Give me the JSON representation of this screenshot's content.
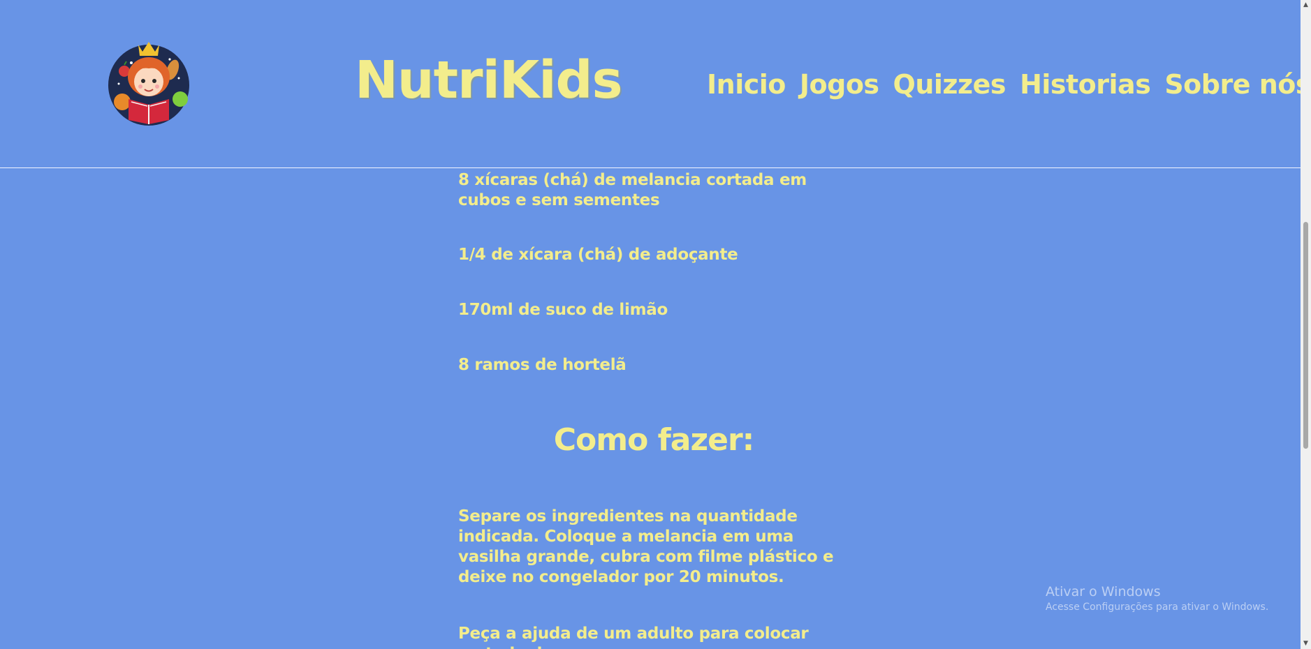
{
  "header": {
    "brand": "NutriKids",
    "nav": [
      {
        "label": "Inicio"
      },
      {
        "label": "Jogos"
      },
      {
        "label": "Quizzes"
      },
      {
        "label": "Historias"
      },
      {
        "label": "Sobre nós"
      }
    ]
  },
  "recipe": {
    "ingredients": [
      "8 xícaras (chá) de melancia cortada em cubos e sem sementes",
      "1/4 de xícara (chá) de adoçante",
      "170ml de suco de limão",
      "8 ramos de hortelã"
    ],
    "how_to_title": "Como fazer:",
    "steps": [
      "Separe os ingredientes na quantidade indicada. Coloque a melancia em uma vasilha grande, cubra com filme plástico e deixe no congelador por 20 minutos.",
      "Peça a ajuda de um adulto para colocar metade da"
    ]
  },
  "watermark": {
    "title": "Ativar o Windows",
    "subtitle": "Acesse Configurações para ativar o Windows."
  },
  "colors": {
    "background": "#6894e6",
    "text": "#f3ed8c",
    "divider": "#f3f6ff"
  },
  "icons": {
    "logo": "chef-girl-reading-book-logo",
    "scroll_up": "arrow-up-icon",
    "scroll_down": "arrow-down-icon"
  }
}
